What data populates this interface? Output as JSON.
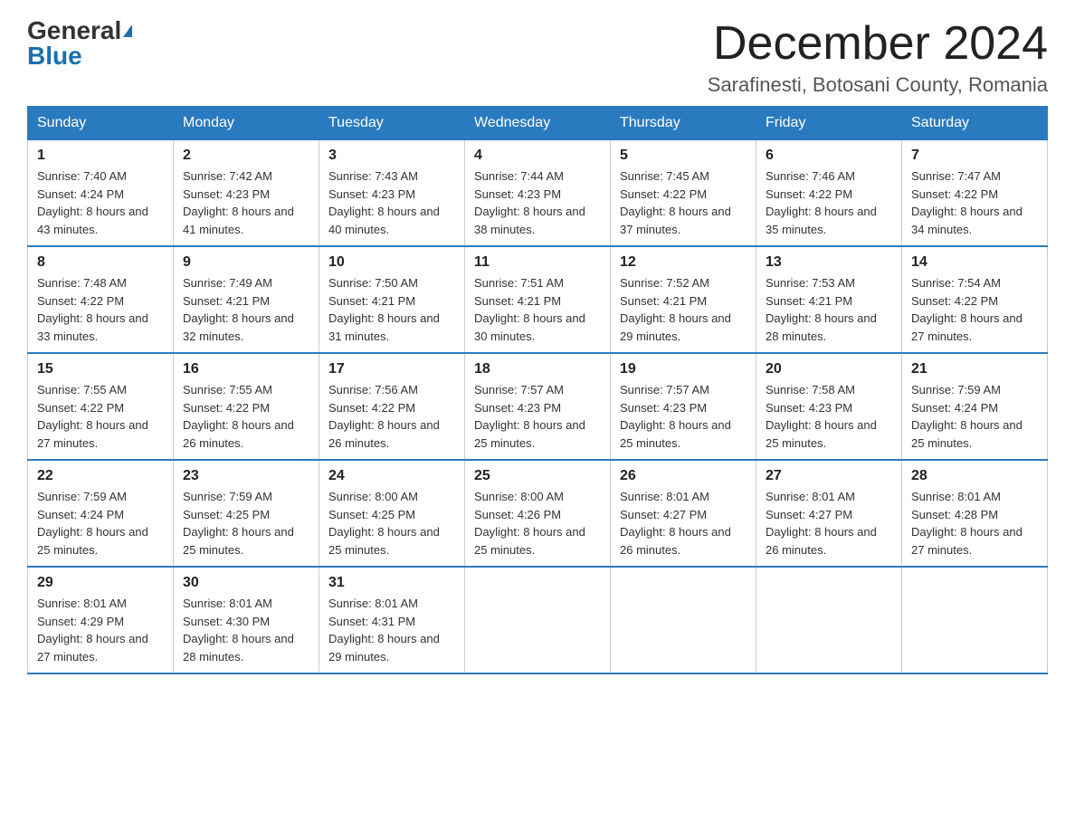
{
  "header": {
    "logo_general": "General",
    "logo_blue": "Blue",
    "title": "December 2024",
    "subtitle": "Sarafinesti, Botosani County, Romania"
  },
  "calendar": {
    "days_of_week": [
      "Sunday",
      "Monday",
      "Tuesday",
      "Wednesday",
      "Thursday",
      "Friday",
      "Saturday"
    ],
    "weeks": [
      [
        {
          "day": "1",
          "sunrise": "7:40 AM",
          "sunset": "4:24 PM",
          "daylight": "8 hours and 43 minutes."
        },
        {
          "day": "2",
          "sunrise": "7:42 AM",
          "sunset": "4:23 PM",
          "daylight": "8 hours and 41 minutes."
        },
        {
          "day": "3",
          "sunrise": "7:43 AM",
          "sunset": "4:23 PM",
          "daylight": "8 hours and 40 minutes."
        },
        {
          "day": "4",
          "sunrise": "7:44 AM",
          "sunset": "4:23 PM",
          "daylight": "8 hours and 38 minutes."
        },
        {
          "day": "5",
          "sunrise": "7:45 AM",
          "sunset": "4:22 PM",
          "daylight": "8 hours and 37 minutes."
        },
        {
          "day": "6",
          "sunrise": "7:46 AM",
          "sunset": "4:22 PM",
          "daylight": "8 hours and 35 minutes."
        },
        {
          "day": "7",
          "sunrise": "7:47 AM",
          "sunset": "4:22 PM",
          "daylight": "8 hours and 34 minutes."
        }
      ],
      [
        {
          "day": "8",
          "sunrise": "7:48 AM",
          "sunset": "4:22 PM",
          "daylight": "8 hours and 33 minutes."
        },
        {
          "day": "9",
          "sunrise": "7:49 AM",
          "sunset": "4:21 PM",
          "daylight": "8 hours and 32 minutes."
        },
        {
          "day": "10",
          "sunrise": "7:50 AM",
          "sunset": "4:21 PM",
          "daylight": "8 hours and 31 minutes."
        },
        {
          "day": "11",
          "sunrise": "7:51 AM",
          "sunset": "4:21 PM",
          "daylight": "8 hours and 30 minutes."
        },
        {
          "day": "12",
          "sunrise": "7:52 AM",
          "sunset": "4:21 PM",
          "daylight": "8 hours and 29 minutes."
        },
        {
          "day": "13",
          "sunrise": "7:53 AM",
          "sunset": "4:21 PM",
          "daylight": "8 hours and 28 minutes."
        },
        {
          "day": "14",
          "sunrise": "7:54 AM",
          "sunset": "4:22 PM",
          "daylight": "8 hours and 27 minutes."
        }
      ],
      [
        {
          "day": "15",
          "sunrise": "7:55 AM",
          "sunset": "4:22 PM",
          "daylight": "8 hours and 27 minutes."
        },
        {
          "day": "16",
          "sunrise": "7:55 AM",
          "sunset": "4:22 PM",
          "daylight": "8 hours and 26 minutes."
        },
        {
          "day": "17",
          "sunrise": "7:56 AM",
          "sunset": "4:22 PM",
          "daylight": "8 hours and 26 minutes."
        },
        {
          "day": "18",
          "sunrise": "7:57 AM",
          "sunset": "4:23 PM",
          "daylight": "8 hours and 25 minutes."
        },
        {
          "day": "19",
          "sunrise": "7:57 AM",
          "sunset": "4:23 PM",
          "daylight": "8 hours and 25 minutes."
        },
        {
          "day": "20",
          "sunrise": "7:58 AM",
          "sunset": "4:23 PM",
          "daylight": "8 hours and 25 minutes."
        },
        {
          "day": "21",
          "sunrise": "7:59 AM",
          "sunset": "4:24 PM",
          "daylight": "8 hours and 25 minutes."
        }
      ],
      [
        {
          "day": "22",
          "sunrise": "7:59 AM",
          "sunset": "4:24 PM",
          "daylight": "8 hours and 25 minutes."
        },
        {
          "day": "23",
          "sunrise": "7:59 AM",
          "sunset": "4:25 PM",
          "daylight": "8 hours and 25 minutes."
        },
        {
          "day": "24",
          "sunrise": "8:00 AM",
          "sunset": "4:25 PM",
          "daylight": "8 hours and 25 minutes."
        },
        {
          "day": "25",
          "sunrise": "8:00 AM",
          "sunset": "4:26 PM",
          "daylight": "8 hours and 25 minutes."
        },
        {
          "day": "26",
          "sunrise": "8:01 AM",
          "sunset": "4:27 PM",
          "daylight": "8 hours and 26 minutes."
        },
        {
          "day": "27",
          "sunrise": "8:01 AM",
          "sunset": "4:27 PM",
          "daylight": "8 hours and 26 minutes."
        },
        {
          "day": "28",
          "sunrise": "8:01 AM",
          "sunset": "4:28 PM",
          "daylight": "8 hours and 27 minutes."
        }
      ],
      [
        {
          "day": "29",
          "sunrise": "8:01 AM",
          "sunset": "4:29 PM",
          "daylight": "8 hours and 27 minutes."
        },
        {
          "day": "30",
          "sunrise": "8:01 AM",
          "sunset": "4:30 PM",
          "daylight": "8 hours and 28 minutes."
        },
        {
          "day": "31",
          "sunrise": "8:01 AM",
          "sunset": "4:31 PM",
          "daylight": "8 hours and 29 minutes."
        },
        null,
        null,
        null,
        null
      ]
    ],
    "sunrise_label": "Sunrise:",
    "sunset_label": "Sunset:",
    "daylight_label": "Daylight:"
  }
}
